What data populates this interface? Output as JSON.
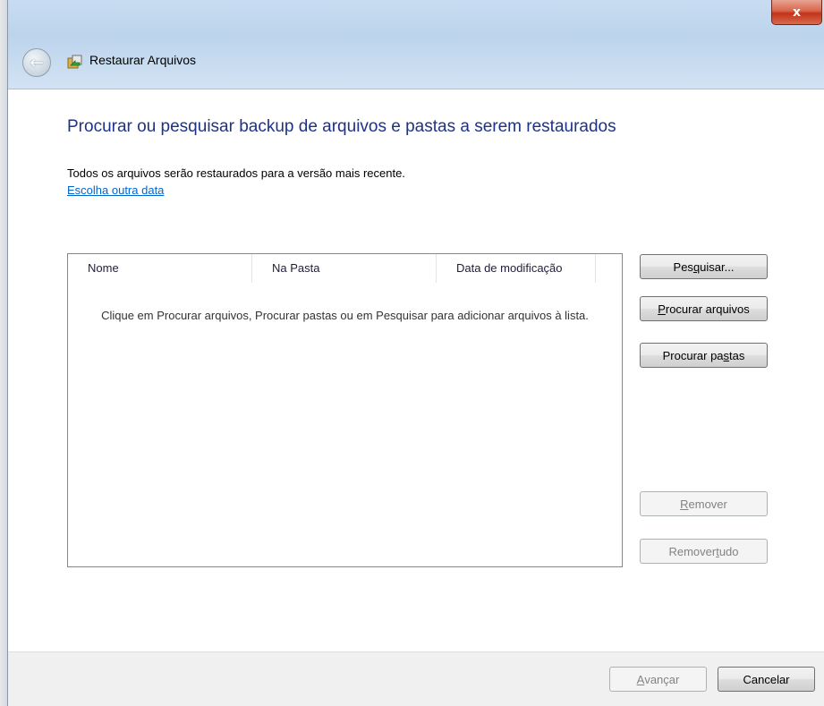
{
  "window": {
    "title": "Restaurar Arquivos",
    "close_label": "x"
  },
  "page": {
    "heading": "Procurar ou pesquisar backup de arquivos e pastas a serem restaurados",
    "info_text": "Todos os arquivos serão restaurados para a versão mais recente.",
    "choose_date_link": "Escolha outra data"
  },
  "list": {
    "columns": [
      "Nome",
      "Na Pasta",
      "Data de modificação"
    ],
    "empty_message": "Clique em Procurar arquivos, Procurar pastas ou em Pesquisar para adicionar arquivos à lista."
  },
  "side_buttons": {
    "search": {
      "pre": "Pes",
      "key": "q",
      "post": "uisar..."
    },
    "browse_files": {
      "pre": "",
      "key": "P",
      "post": "rocurar arquivos"
    },
    "browse_folders": {
      "pre": "Procurar pa",
      "key": "s",
      "post": "tas"
    },
    "remove": {
      "pre": "",
      "key": "R",
      "post": "emover"
    },
    "remove_all": {
      "pre": "Remover ",
      "key": "t",
      "post": "udo"
    }
  },
  "footer": {
    "next": {
      "pre": "",
      "key": "A",
      "post": "vançar"
    },
    "cancel": "Cancelar"
  },
  "colors": {
    "heading": "#1e3287",
    "link": "#0066cc",
    "close": "#c2331a"
  }
}
